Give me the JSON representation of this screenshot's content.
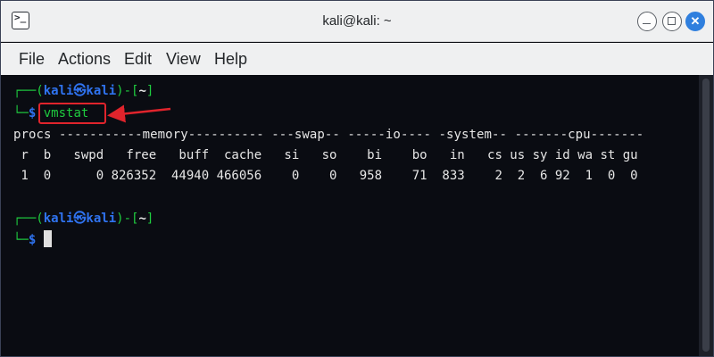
{
  "window": {
    "title": "kali@kali: ~"
  },
  "titlebar_icons": {
    "app": "terminal-icon",
    "minimize": "minimize-icon",
    "maximize": "maximize-icon",
    "close": "close-icon",
    "close_glyph": "✕",
    "app_glyph": ">_"
  },
  "menu": [
    "File",
    "Actions",
    "Edit",
    "View",
    "Help"
  ],
  "prompt": {
    "corner_top": "┌──(",
    "user_host": "kali㉿kali",
    "mid": ")-[",
    "path": "~",
    "end": "]",
    "corner_bottom": "└─",
    "symbol": "$"
  },
  "command": "vmstat",
  "vmstat": {
    "group_header": "procs -----------memory---------- ---swap-- -----io---- -system-- -------cpu-------",
    "column_header": " r  b   swpd   free   buff  cache   si   so    bi    bo   in   cs us sy id wa st gu",
    "row": " 1  0      0 826352  44940 466056    0    0   958    71  833    2  2  6 92  1  0  0"
  },
  "colors": {
    "accent_blue": "#2f73f0",
    "prompt_green": "#1fcc3f",
    "annotation_red": "#e0242c",
    "close_button": "#2f7fde"
  },
  "annotation": {
    "type": "red-box-with-arrow",
    "target": "vmstat"
  }
}
